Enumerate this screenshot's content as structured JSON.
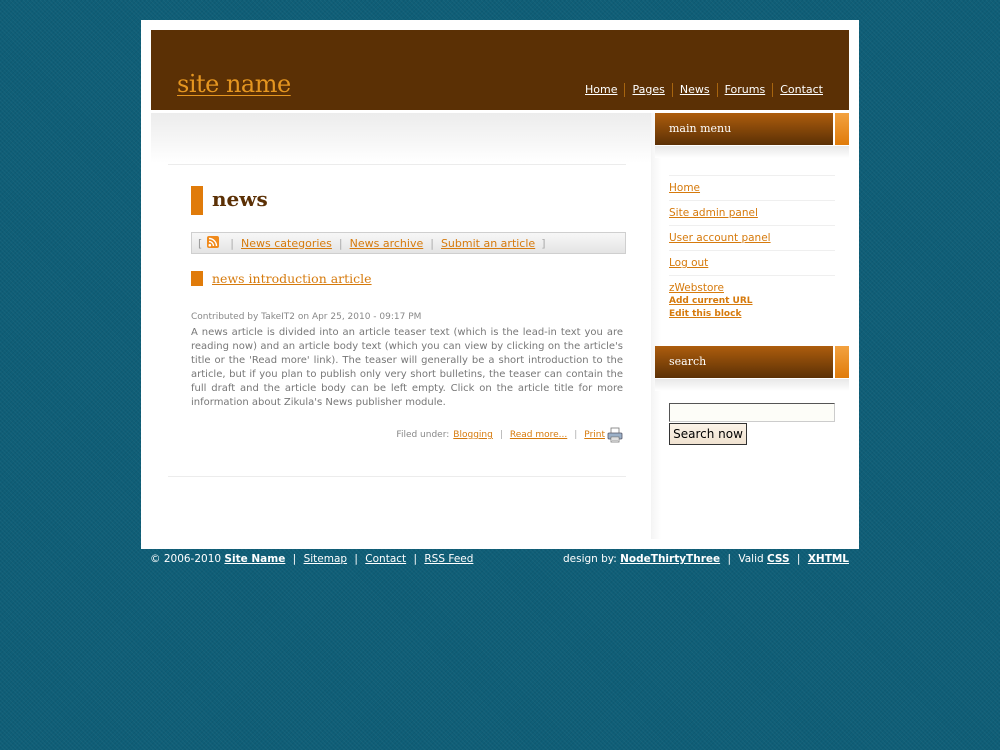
{
  "header": {
    "site_name": "site name",
    "nav": [
      "Home",
      "Pages",
      "News",
      "Forums",
      "Contact"
    ]
  },
  "main": {
    "title": "news",
    "linkbar": {
      "open_bracket": "[",
      "close_bracket": "]",
      "links": [
        "News categories",
        "News archive",
        "Submit an article"
      ]
    },
    "article": {
      "title": "news introduction article",
      "byline": "Contributed by TakeIT2 on Apr 25, 2010 - 09:17 PM",
      "teaser": "A news article is divided into an article teaser text (which is the lead-in text you are reading now) and an article body text (which you can view by clicking on the article's title or the 'Read more' link). The teaser will generally be a short introduction to the article, but if you plan to publish only very short bulletins, the teaser can contain the full draft and the article body can be left empty. Click on the article title for more information about Zikula's News publisher module.",
      "filed_under_label": "Filed under:",
      "category": "Blogging",
      "read_more": "Read more...",
      "print": "Print"
    }
  },
  "sidebar": {
    "menu_title": "main menu",
    "menu_items": [
      "Home",
      "Site admin panel",
      "User account panel",
      "Log out",
      "zWebstore"
    ],
    "block_links": [
      "Add current URL",
      "Edit this block"
    ],
    "search_title": "search",
    "search_value": "",
    "search_button": "Search now"
  },
  "footer": {
    "copyright": "© 2006-2010",
    "site_name": "Site Name",
    "links": [
      "Sitemap",
      "Contact",
      "RSS Feed"
    ],
    "design_by_label": "design by:",
    "designer": "NodeThirtyThree",
    "valid_label": "Valid",
    "css": "CSS",
    "xhtml": "XHTML"
  },
  "colors": {
    "background": "#0f5e77",
    "header": "#5b3005",
    "accent": "#e07b0a",
    "link": "#d67a0c"
  }
}
